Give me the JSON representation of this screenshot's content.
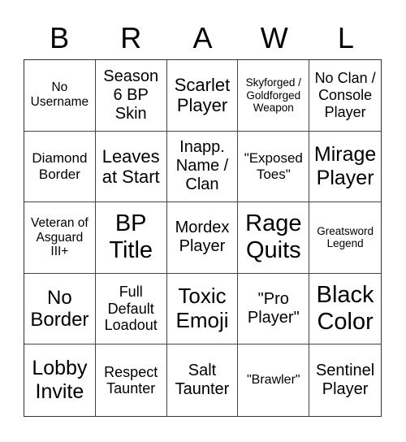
{
  "header": [
    "B",
    "R",
    "A",
    "W",
    "L"
  ],
  "cells": [
    "No Username",
    "Season 6 BP Skin",
    "Scarlet Player",
    "Skyforged / Goldforged Weapon",
    "No Clan / Console Player",
    "Diamond Border",
    "Leaves at Start",
    "Inapp. Name / Clan",
    "\"Exposed Toes\"",
    "Mirage Player",
    "Veteran of Asguard III+",
    "BP Title",
    "Mordex Player",
    "Rage Quits",
    "Greatsword Legend",
    "No Border",
    "Full Default Loadout",
    "Toxic Emoji",
    "\"Pro Player\"",
    "Black Color",
    "Lobby Invite",
    "Respect Taunter",
    "Salt Taunter",
    "\"Brawler\"",
    "Sentinel Player"
  ]
}
